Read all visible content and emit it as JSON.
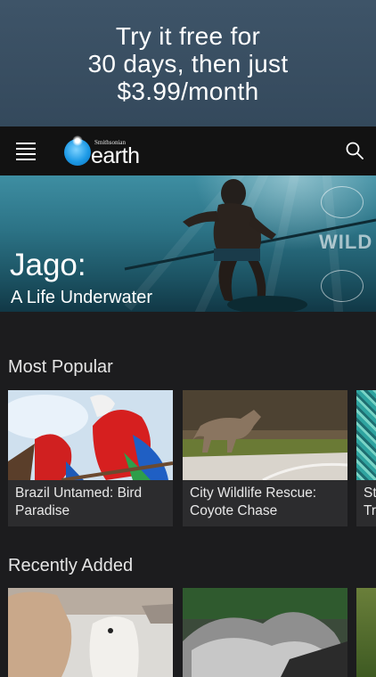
{
  "promo": {
    "text": "Try it free for\n30 days, then just\n$3.99/month"
  },
  "navbar": {
    "logo_small": "Smithsonian",
    "logo_big": "earth",
    "menu_icon": "hamburger-menu-icon",
    "search_icon": "search-icon"
  },
  "hero": {
    "title": "Jago:",
    "subtitle": "A Life Underwater"
  },
  "sections": {
    "most_popular": {
      "title": "Most Popular",
      "cards": [
        {
          "label": "Brazil Untamed: Bird Paradise"
        },
        {
          "label": "City Wildlife Rescue: Coyote Chase"
        },
        {
          "label": "St\nTr"
        }
      ]
    },
    "recently_added": {
      "title": "Recently Added"
    }
  },
  "colors": {
    "promo_bg": "#3a4f63",
    "nav_bg": "#121212",
    "page_bg": "#1c1c1e",
    "card_bg": "#2c2c2e"
  }
}
